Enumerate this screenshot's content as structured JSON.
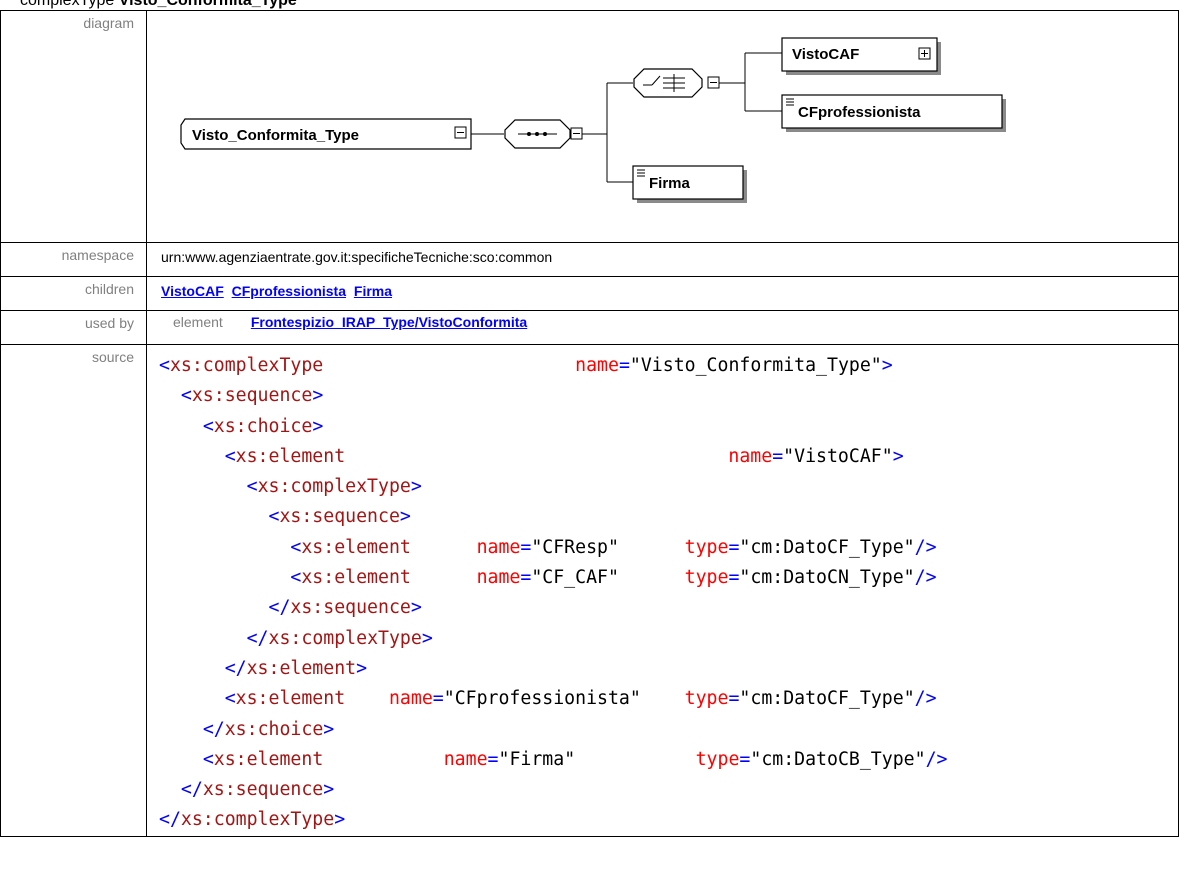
{
  "heading": {
    "prefix": "complexType ",
    "name": "Visto_Conformita_Type"
  },
  "rows": {
    "diagram": {
      "label": "diagram"
    },
    "namespace": {
      "label": "namespace",
      "value": "urn:www.agenziaentrate.gov.it:specificheTecniche:sco:common"
    },
    "children": {
      "label": "children",
      "items": [
        "VistoCAF",
        "CFprofessionista",
        "Firma"
      ]
    },
    "used_by": {
      "label": "used by",
      "kind": "element",
      "link": "Frontespizio_IRAP_Type/VistoConformita"
    },
    "source": {
      "label": "source"
    }
  },
  "diagram": {
    "root": "Visto_Conformita_Type",
    "nodes": [
      "VistoCAF",
      "CFprofessionista",
      "Firma"
    ]
  },
  "source": {
    "lines": [
      "<xs:complexType                       name=\"Visto_Conformita_Type\">",
      "  <xs:sequence>",
      "    <xs:choice>",
      "      <xs:element                                   name=\"VistoCAF\">",
      "        <xs:complexType>",
      "          <xs:sequence>",
      "            <xs:element      name=\"CFResp\"      type=\"cm:DatoCF_Type\"/>",
      "            <xs:element      name=\"CF_CAF\"      type=\"cm:DatoCN_Type\"/>",
      "          </xs:sequence>",
      "        </xs:complexType>",
      "      </xs:element>",
      "      <xs:element    name=\"CFprofessionista\"    type=\"cm:DatoCF_Type\"/>",
      "    </xs:choice>",
      "    <xs:element           name=\"Firma\"           type=\"cm:DatoCB_Type\"/>",
      "  </xs:sequence>",
      "</xs:complexType>"
    ]
  }
}
